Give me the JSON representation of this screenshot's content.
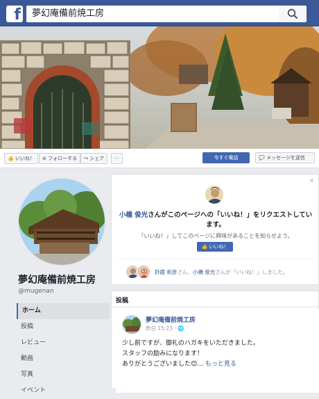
{
  "header": {
    "logo": "f",
    "search_value": "夢幻庵備前焼工房",
    "search_icon": "search-icon"
  },
  "actions": {
    "like": "いいね！",
    "follow": "フォローする",
    "share": "シェア",
    "more": "···",
    "call": "今すぐ電話",
    "message": "メッセージを送信"
  },
  "page": {
    "name": "夢幻庵備前焼工房",
    "handle": "@mugenan"
  },
  "nav": {
    "items": [
      "ホーム",
      "投稿",
      "レビュー",
      "動画",
      "写真",
      "イベント"
    ]
  },
  "request": {
    "close": "×",
    "requester": "小橋 俊光",
    "title_rest": "さんがこのページへの「いいね！」をリクエストしています。",
    "subtitle": "「いいね！」してこのページに興味があることを知らせよう。",
    "like_button": "いいね！",
    "liker1": "鈴鹿 和彦",
    "liker_sep": "さん、",
    "liker2": "小橋 俊光",
    "liker_rest": "さんが「いいね！」しました。"
  },
  "posts": {
    "header": "投稿",
    "author": "夢幻庵備前焼工房",
    "meta": "昨日 15:23 · 🌐",
    "line1": "少し前ですが、御礼のハガキをいただきました。",
    "line2": "スタッフの励みになります！",
    "line3": "ありがとうございました😊...",
    "more": "もっと見る"
  },
  "colors": {
    "brand": "#3b5998",
    "button": "#4267b2",
    "link": "#365899"
  }
}
